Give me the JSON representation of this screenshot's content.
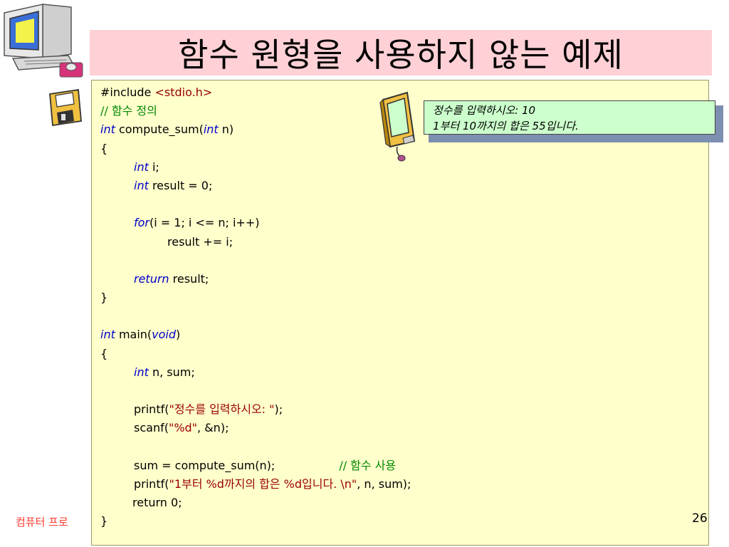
{
  "slide": {
    "title": "함수 원형을 사용하지 않는 예제",
    "footer": "컴퓨터 프로",
    "page_number": "26"
  },
  "code": {
    "l1a": "#include ",
    "l1b": "<stdio.h>",
    "l2": "// 함수 정의",
    "l3_kw": "int",
    "l3_mid": " compute_sum(",
    "l3_kw2": "int",
    "l3_end": " n)",
    "l4": "{",
    "l5_kw": "int",
    "l5_rest": " i;",
    "l6_kw": "int",
    "l6_rest": " result = 0;",
    "l8_kw": "for",
    "l8_rest": "(i = 1; i <= n; i++)",
    "l9": "result += i;",
    "l11_kw": "return",
    "l11_rest": " result;",
    "l12": "}",
    "l14_kw": "int",
    "l14_mid": " main(",
    "l14_kw2": "void",
    "l14_end": ")",
    "l15": "{",
    "l16_kw": "int",
    "l16_rest": " n, sum;",
    "l18_a": "printf(",
    "l18_str": "\"정수를 입력하시오: \"",
    "l18_b": ");",
    "l19_a": "scanf(",
    "l19_str": "\"%d\"",
    "l19_b": ", &n);",
    "l21_a": "sum = compute_sum(n);",
    "l21_cm": "// 함수 사용",
    "l22_a": "printf(",
    "l22_str": "\"1부터 %d까지의 합은 %d입니다. \\n\"",
    "l22_b": ", n, sum);",
    "l23": "return 0;",
    "l24": "}"
  },
  "output": {
    "line1": "정수를 입력하시오: 10",
    "line2": "1부터 10까지의 합은 55입니다."
  },
  "colors": {
    "title_bg": "#ffd1d6",
    "code_bg": "#ffffcc",
    "output_bg": "#ccffcc",
    "keyword": "#0000cc",
    "comment": "#008800",
    "string": "#990000",
    "footer": "#ff3b30"
  },
  "icons": [
    "computer-clipart-icon",
    "floppy-disk-icon",
    "monitor-clipart-icon"
  ]
}
